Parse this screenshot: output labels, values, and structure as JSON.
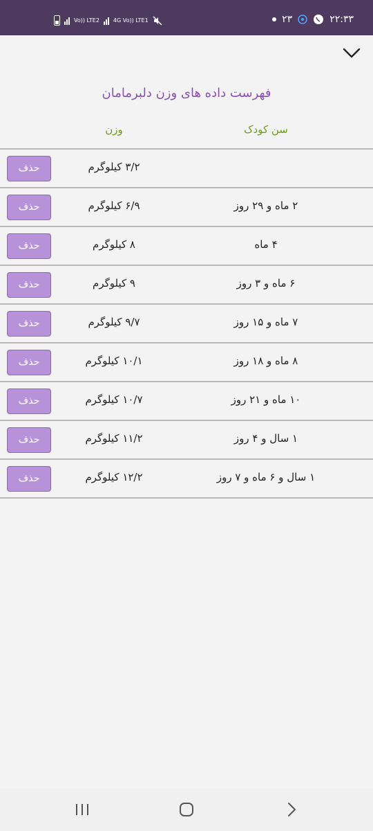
{
  "status_bar": {
    "time": "۲۲:۳۳",
    "date_day": "۲۳",
    "network_1": "Vo)) LTE2",
    "network_2": "4G Vo)) LTE1"
  },
  "page": {
    "title": "فهرست داده های وزن دلبرمامان",
    "col_age": "سن کودک",
    "col_weight": "وزن"
  },
  "rows": [
    {
      "age": "",
      "weight": "۳/۲ کیلوگرم",
      "delete": "حذف"
    },
    {
      "age": "۲ ماه و ۲۹ روز",
      "weight": "۶/۹ کیلوگرم",
      "delete": "حذف"
    },
    {
      "age": "۴ ماه",
      "weight": "۸ کیلوگرم",
      "delete": "حذف"
    },
    {
      "age": "۶ ماه و ۳ روز",
      "weight": "۹ کیلوگرم",
      "delete": "حذف"
    },
    {
      "age": "۷ ماه و ۱۵ روز",
      "weight": "۹/۷ کیلوگرم",
      "delete": "حذف"
    },
    {
      "age": "۸ ماه و ۱۸ روز",
      "weight": "۱۰/۱ کیلوگرم",
      "delete": "حذف"
    },
    {
      "age": "۱۰ ماه و ۲۱ روز",
      "weight": "۱۰/۷ کیلوگرم",
      "delete": "حذف"
    },
    {
      "age": "۱ سال و ۴ روز",
      "weight": "۱۱/۲ کیلوگرم",
      "delete": "حذف"
    },
    {
      "age": "۱ سال و ۶ ماه و ۷ روز",
      "weight": "۱۲/۲ کیلوگرم",
      "delete": "حذف"
    }
  ],
  "icons": {
    "collapse": "chevron-down-icon",
    "recent": "recent-apps-icon",
    "home": "home-icon",
    "back": "back-icon"
  },
  "colors": {
    "status_bar": "#4e3a5e",
    "title": "#8a4fb0",
    "column_header": "#6f9a1c",
    "delete_button": "#b792d8"
  }
}
